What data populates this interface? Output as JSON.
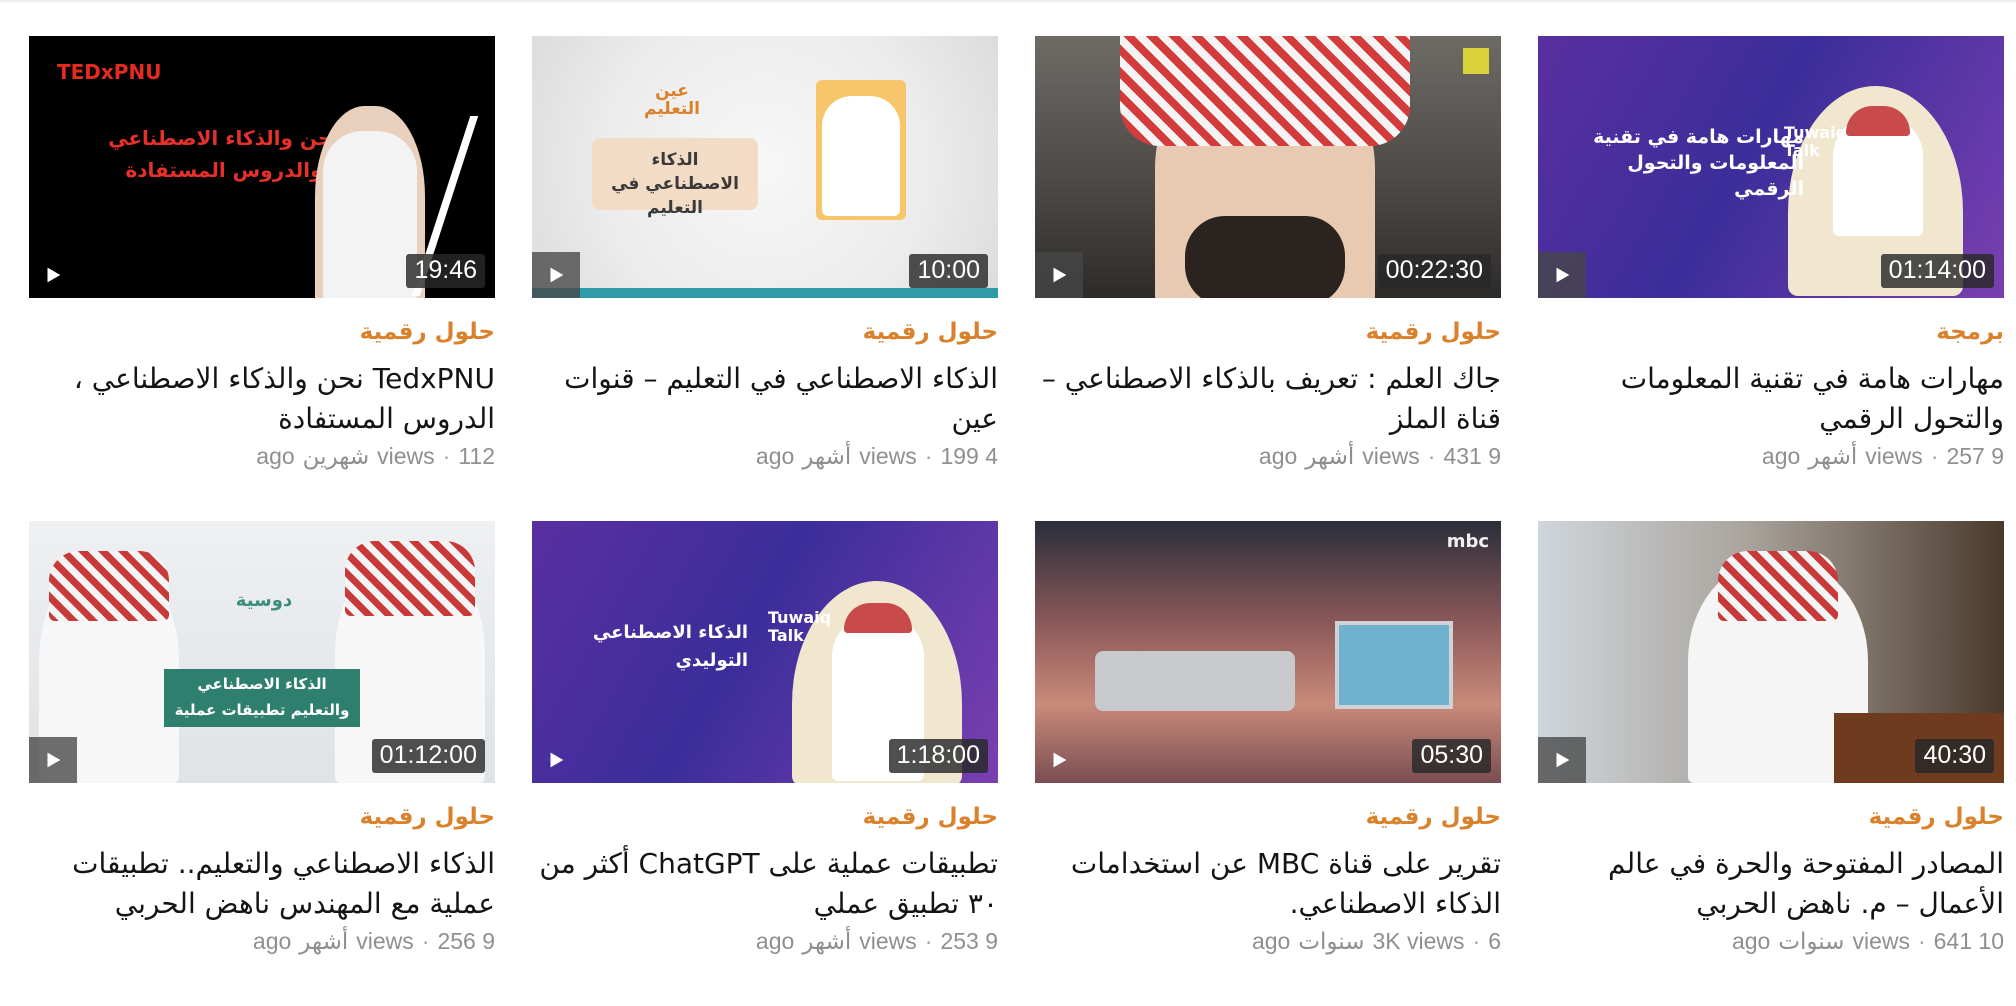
{
  "videos": [
    {
      "category": "برمجة",
      "title": "مهارات هامة في تقنية المعلومات والتحول الرقمي",
      "views": "9 257",
      "views_label": "views",
      "age": "أشهر",
      "ago": "ago",
      "duration": "01:14:00",
      "thumb_headline": "مهارات هامة في تقنية المعلومات والتحول الرقمي",
      "thumb_brand": "Tuwaiq Talk"
    },
    {
      "category": "حلول رقمية",
      "title": "جاك العلم : تعريف بالذكاء الاصطناعي – قناة الملز",
      "views": "9 431",
      "views_label": "views",
      "age": "أشهر",
      "ago": "ago",
      "duration": "00:22:30",
      "thumb_headline": "",
      "thumb_brand": ""
    },
    {
      "category": "حلول رقمية",
      "title": "الذكاء الاصطناعي في التعليم – قنوات عين",
      "views": "4 199",
      "views_label": "views",
      "age": "أشهر",
      "ago": "ago",
      "duration": "10:00",
      "thumb_headline": "الذكاء الاصطناعي في التعليم",
      "thumb_brand": "عين التعليم"
    },
    {
      "category": "حلول رقمية",
      "title": "TedxPNU نحن والذكاء الاصطناعي ، الدروس المستفادة",
      "views": "112",
      "views_label": "views",
      "age": "شهرين",
      "ago": "ago",
      "duration": "19:46",
      "thumb_headline": "نحن والذكاء الاصطناعي والدروس المستفادة",
      "thumb_brand": "TEDxPNU"
    },
    {
      "category": "حلول رقمية",
      "title": "المصادر المفتوحة والحرة في عالم الأعمال – م. ناهض الحربي",
      "views": "10 641",
      "views_label": "views",
      "age": "سنوات",
      "ago": "ago",
      "duration": "40:30",
      "thumb_headline": "",
      "thumb_brand": ""
    },
    {
      "category": "حلول رقمية",
      "title": "تقرير على قناة MBC عن استخدامات الذكاء الاصطناعي.",
      "views": "6",
      "views_label": "3K views",
      "age": "سنوات",
      "ago": "ago",
      "duration": "05:30",
      "thumb_headline": "",
      "thumb_brand": "mbc"
    },
    {
      "category": "حلول رقمية",
      "title": "تطبيقات عملية على ChatGPT أكثر من ٣٠ تطبيق عملي",
      "views": "9 253",
      "views_label": "views",
      "age": "أشهر",
      "ago": "ago",
      "duration": "1:18:00",
      "thumb_headline": "الذكاء الاصطناعي التوليدي",
      "thumb_brand": "Tuwaiq Talk"
    },
    {
      "category": "حلول رقمية",
      "title": "الذكاء الاصطناعي والتعليم.. تطبيقات عملية مع المهندس ناهض الحربي",
      "views": "9 256",
      "views_label": "views",
      "age": "أشهر",
      "ago": "ago",
      "duration": "01:12:00",
      "thumb_headline": "الذكاء الاصطناعي والتعليم تطبيقات عملية",
      "thumb_brand": "دوسية"
    }
  ],
  "icons": {
    "play": "play-icon"
  },
  "colors": {
    "category": "#d9822b",
    "title": "#141414",
    "meta": "#8f8f8f"
  }
}
